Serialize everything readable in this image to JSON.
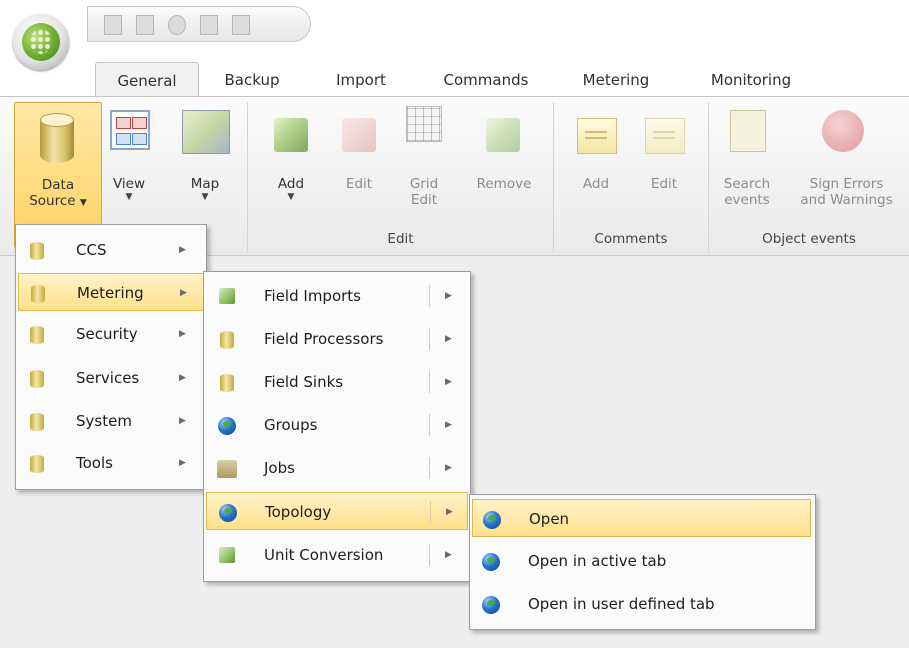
{
  "tabs": [
    "General",
    "Backup",
    "Import",
    "Commands",
    "Metering",
    "Monitoring"
  ],
  "ribbon": {
    "data_source": {
      "line1": "Data",
      "line2": "Source"
    },
    "view": "View",
    "map": "Map",
    "add": "Add",
    "edit": "Edit",
    "grid_edit": {
      "line1": "Grid",
      "line2": "Edit"
    },
    "remove": "Remove",
    "comment_add": "Add",
    "comment_edit": "Edit",
    "search_events": {
      "line1": "Search",
      "line2": "events"
    },
    "sign_errors": {
      "line1": "Sign Errors",
      "line2": "and Warnings"
    },
    "groups": {
      "edit": "Edit",
      "comments": "Comments",
      "object_events": "Object events"
    }
  },
  "menu_datasource": [
    "CCS",
    "Metering",
    "Security",
    "Services",
    "System",
    "Tools"
  ],
  "menu_metering": [
    "Field Imports",
    "Field Processors",
    "Field Sinks",
    "Groups",
    "Jobs",
    "Topology",
    "Unit Conversion"
  ],
  "menu_topology": [
    "Open",
    "Open in active tab",
    "Open in user defined tab"
  ],
  "icons": {
    "submenu": "▶",
    "dropdown": "▼"
  }
}
